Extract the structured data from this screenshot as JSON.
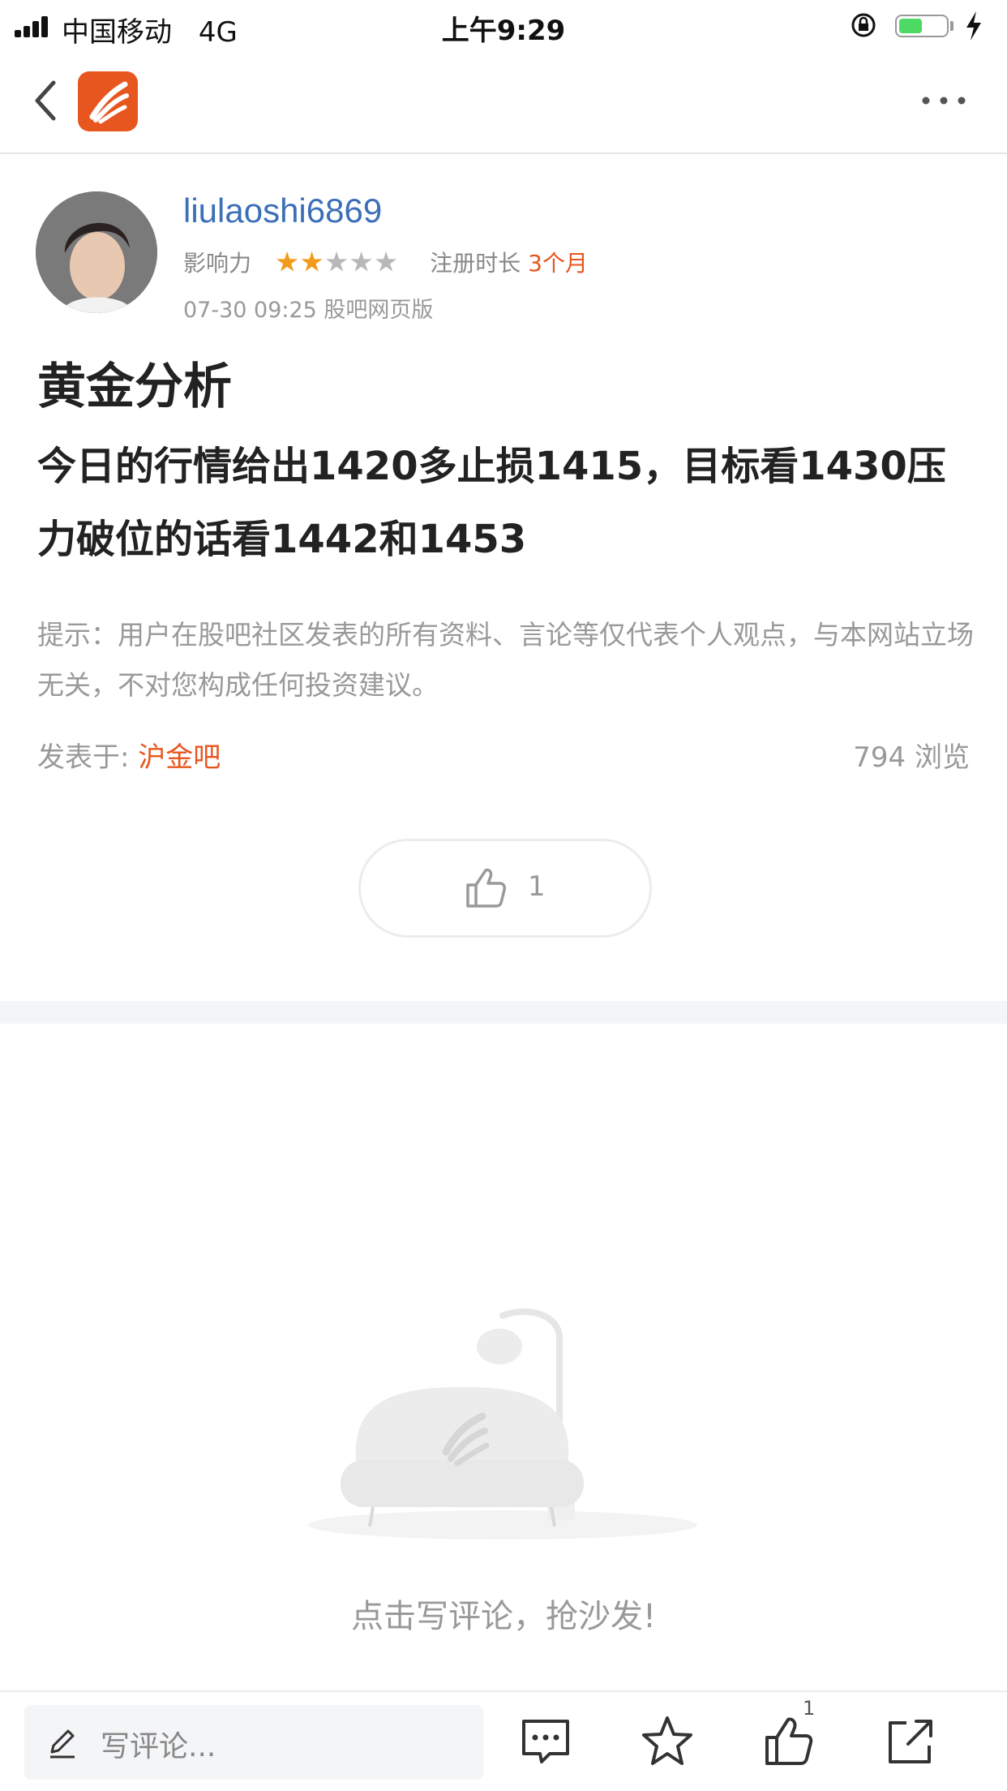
{
  "status_bar": {
    "carrier": "中国移动",
    "network": "4G",
    "time": "上午9:29"
  },
  "nav": {
    "back_icon": "chevron-left-icon",
    "app_logo_icon": "guba-logo-icon",
    "more_icon": "more-horizontal-icon"
  },
  "author": {
    "username": "liulaoshi6869",
    "influence_label": "影响力",
    "influence_stars": 2,
    "influence_stars_max": 5,
    "reg_label": "注册时长",
    "reg_value": "3个月",
    "post_time": "07-30 09:25 股吧网页版"
  },
  "post": {
    "title": "黄金分析",
    "body": "今日的行情给出1420多止损1415，目标看1430压力破位的话看1442和1453",
    "disclaimer": "提示：用户在股吧社区发表的所有资料、言论等仅代表个人观点，与本网站立场无关，不对您构成任何投资建议。",
    "posted_in_label": "发表于:",
    "forum": "沪金吧",
    "views": "794 浏览",
    "like_count": "1"
  },
  "empty_state": {
    "text": "点击写评论，抢沙发!"
  },
  "bottom_bar": {
    "comment_placeholder": "写评论...",
    "like_badge": "1",
    "icons": [
      "comment-icon",
      "star-icon",
      "thumb-up-icon",
      "share-icon"
    ]
  },
  "colors": {
    "accent": "#e8561f",
    "username": "#3b6fb8",
    "star": "#f29b1b"
  }
}
